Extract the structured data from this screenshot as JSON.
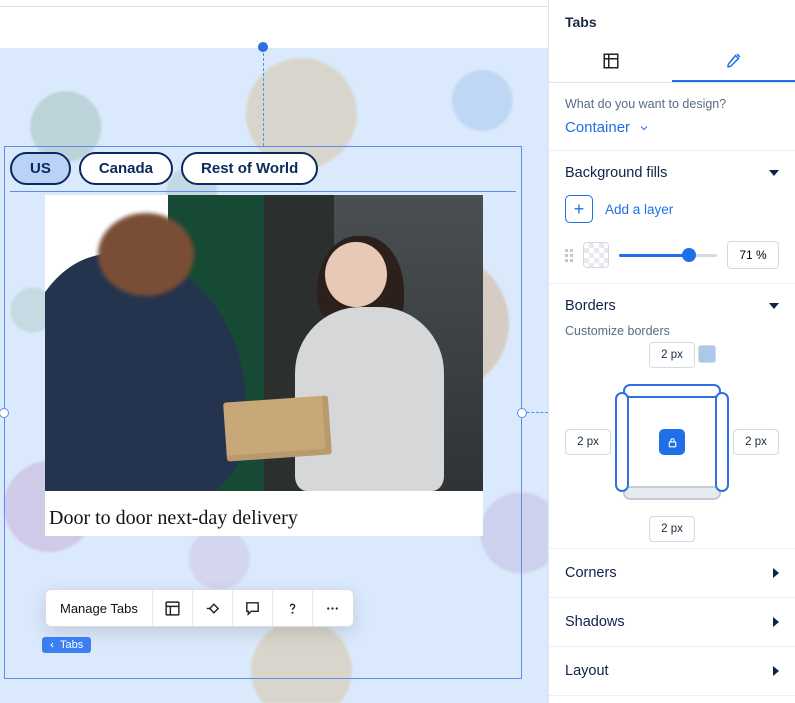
{
  "canvas": {
    "tabs": [
      "US",
      "Canada",
      "Rest of World"
    ],
    "activeTab": 0,
    "caption": "Door to door next-day delivery",
    "toolbar": {
      "manage": "Manage Tabs"
    },
    "tagBadge": "Tabs"
  },
  "panel": {
    "title": "Tabs",
    "designQuestion": "What do you want to design?",
    "designTarget": "Container",
    "sections": {
      "backgroundFills": {
        "title": "Background fills",
        "addLabel": "Add a layer",
        "opacityPercent": 71,
        "opacityDisplay": "71 %"
      },
      "borders": {
        "title": "Borders",
        "customize": "Customize borders",
        "top": "2 px",
        "right": "2 px",
        "bottom": "2 px",
        "left": "2 px",
        "color": "#a9c8ea"
      },
      "corners": "Corners",
      "shadows": "Shadows",
      "layout": "Layout"
    }
  }
}
